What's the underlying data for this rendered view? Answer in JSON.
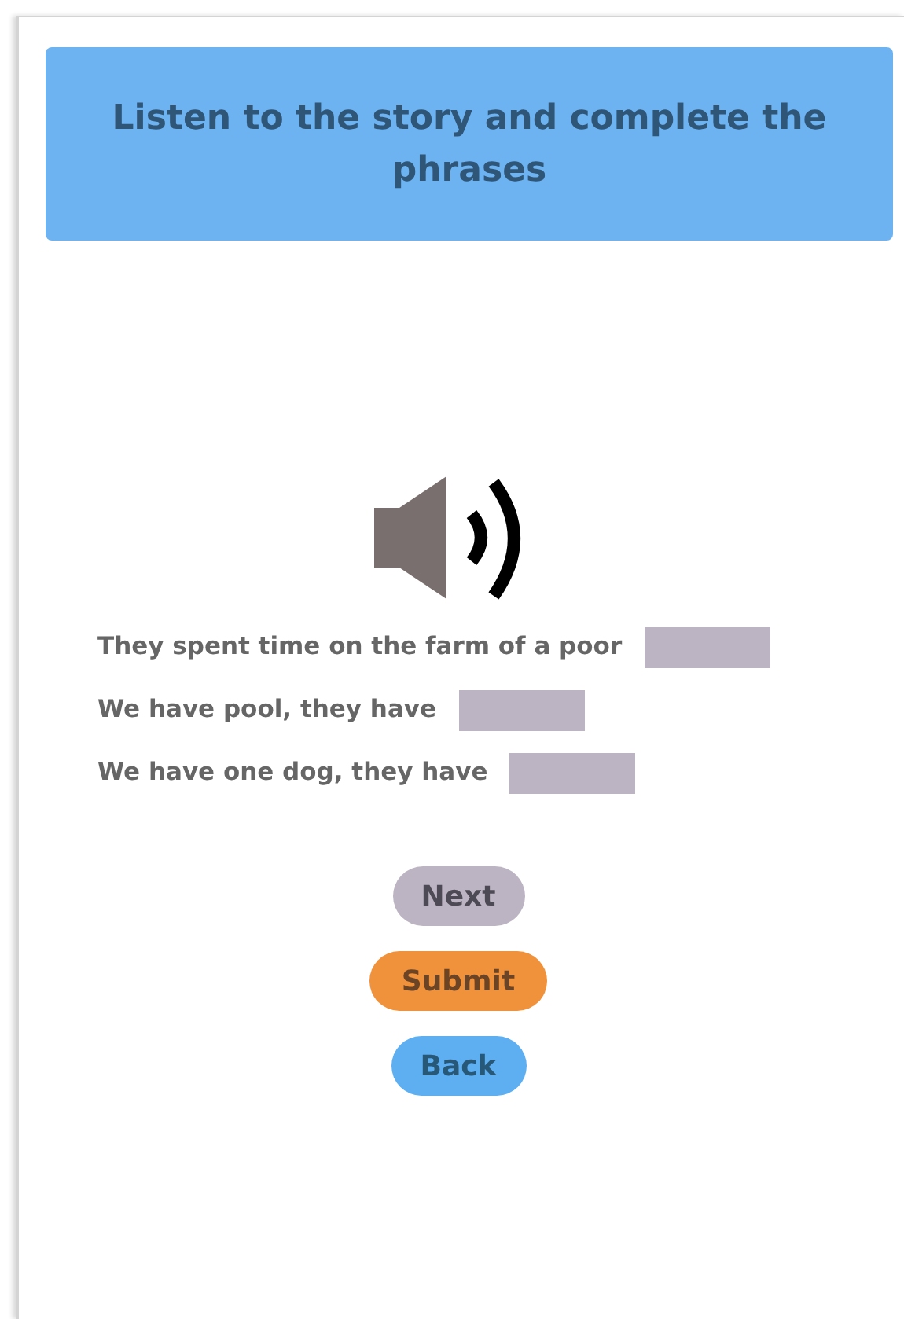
{
  "header": {
    "title": "Listen to the story and complete the phrases"
  },
  "phrases": [
    {
      "text": "They spent time on the farm of a poor"
    },
    {
      "text": "We have pool, they have"
    },
    {
      "text": "We have one dog, they have"
    }
  ],
  "buttons": [
    {
      "label": "Next",
      "kind": "secondary"
    },
    {
      "label": "Submit",
      "kind": "warning"
    },
    {
      "label": "Back",
      "kind": "primary"
    }
  ]
}
